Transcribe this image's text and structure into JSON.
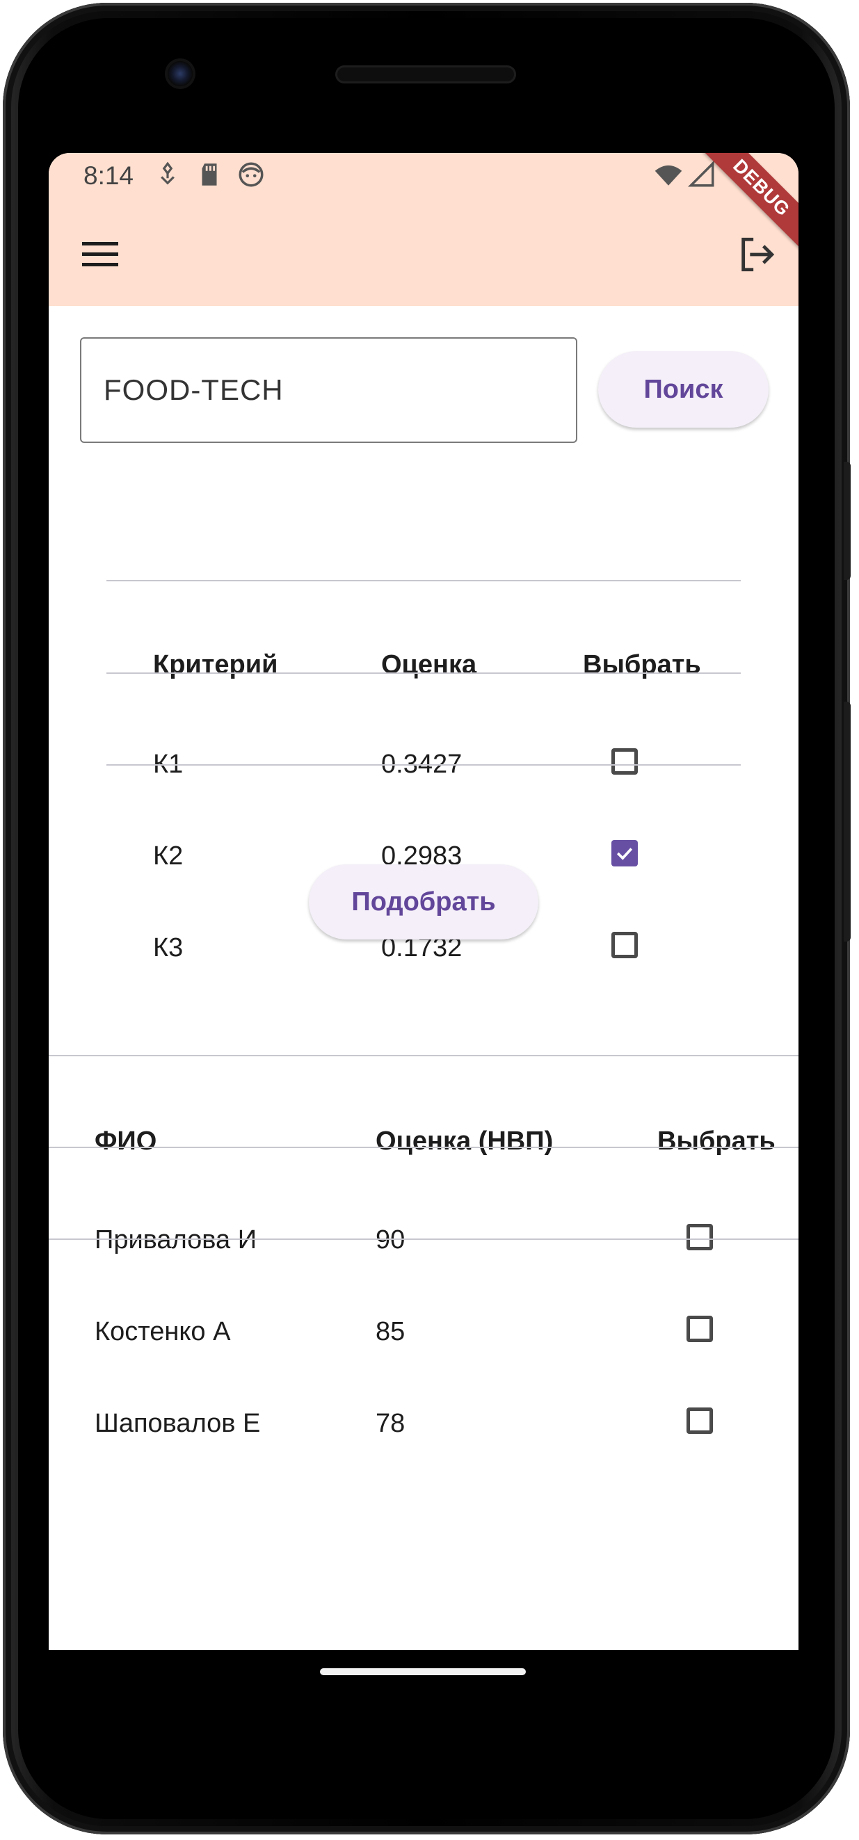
{
  "status_bar": {
    "time": "8:14",
    "left_icons": [
      "download-icon",
      "sd-card-icon",
      "face-icon"
    ],
    "right_icons": [
      "wifi-icon",
      "cell-signal-icon"
    ]
  },
  "app_bar": {
    "background": "#ffdfcf",
    "menu_icon": "hamburger-menu-icon",
    "logout_icon": "logout-icon",
    "debug_banner": "DEBUG"
  },
  "search": {
    "value": "FOOD-TECH",
    "button_label": "Поиск"
  },
  "criteria_table": {
    "headers": [
      "Критерий",
      "Оценка",
      "Выбрать"
    ],
    "rows": [
      {
        "criterion": "К1",
        "score": "0.3427",
        "selected": false
      },
      {
        "criterion": "К2",
        "score": "0.2983",
        "selected": true
      },
      {
        "criterion": "К3",
        "score": "0.1732",
        "selected": false
      }
    ]
  },
  "match_button_label": "Подобрать",
  "people_table": {
    "headers": [
      "ФИО",
      "Оценка (НВП)",
      "Выбрать"
    ],
    "rows": [
      {
        "name": "Привалова И",
        "score": "90",
        "selected": false
      },
      {
        "name": "Костенко А",
        "score": "85",
        "selected": false
      },
      {
        "name": "Шаповалов Е",
        "score": "78",
        "selected": false
      }
    ]
  },
  "colors": {
    "accent": "#6750a4",
    "button_text": "#62469a",
    "button_bg": "#f4eff8"
  }
}
